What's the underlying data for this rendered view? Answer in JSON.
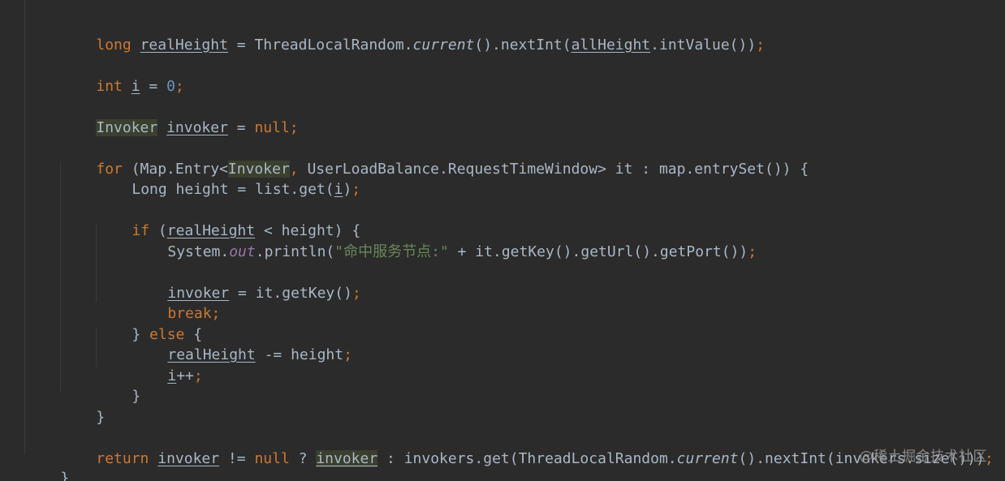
{
  "code": {
    "l1": {
      "kw_long": "long",
      "var": "realHeight",
      "eq": " = ThreadLocalRandom.",
      "current": "current",
      "mid": "().nextInt(",
      "allHeight": "allHeight",
      "tail": ".intValue())",
      "semi": ";"
    },
    "l2": {
      "kw_int": "int",
      "var": "i",
      "eq": " = ",
      "num": "0",
      "semi": ";"
    },
    "l3": {
      "type": "Invoker",
      "var": "invoker",
      "eq": " = ",
      "null": "null",
      "semi": ";"
    },
    "l4": {
      "kw_for": "for",
      "a": " (Map.Entry<",
      "type": "Invoker",
      "comma": ",",
      "b": " UserLoadBalance.RequestTimeWindow> it : map.entrySet()) {"
    },
    "l5": {
      "a": "Long height = list.get(",
      "i": "i",
      "b": ")",
      "semi": ";"
    },
    "l6": {
      "kw_if": "if",
      "a": " (",
      "var": "realHeight",
      "b": " < height) {"
    },
    "l7": {
      "a": "System.",
      "out": "out",
      "b": ".println(",
      "str": "\"命中服务节点:\"",
      "c": " + it.getKey().getUrl().getPort())",
      "semi": ";"
    },
    "l8": {
      "var": "invoker",
      "a": " = it.getKey()",
      "semi": ";"
    },
    "l9": {
      "kw_break": "break",
      "semi": ";"
    },
    "l10": {
      "a": "} ",
      "kw_else": "else",
      "b": " {"
    },
    "l11": {
      "var": "realHeight",
      "a": " -= height",
      "semi": ";"
    },
    "l12": {
      "var": "i",
      "a": "++",
      "semi": ";"
    },
    "l13": {
      "a": "}"
    },
    "l14": {
      "a": "}"
    },
    "l15": {
      "kw_return": "return",
      "sp": " ",
      "var": "invoker",
      "a": " != ",
      "null": "null",
      "b": " ? ",
      "var2": "invoker",
      "c": " : invokers.get(ThreadLocalRandom.",
      "current": "current",
      "d": "().nextInt(invokers.size()))",
      "semi": ";"
    },
    "l16": {
      "a": "}"
    }
  },
  "watermark": "@稀土掘金技术社区",
  "colors": {
    "background": "#2b2b2b",
    "text": "#a9b7c6",
    "keyword": "#cc7832",
    "number": "#6897bb",
    "string": "#6a8759",
    "static_field": "#9876aa"
  }
}
